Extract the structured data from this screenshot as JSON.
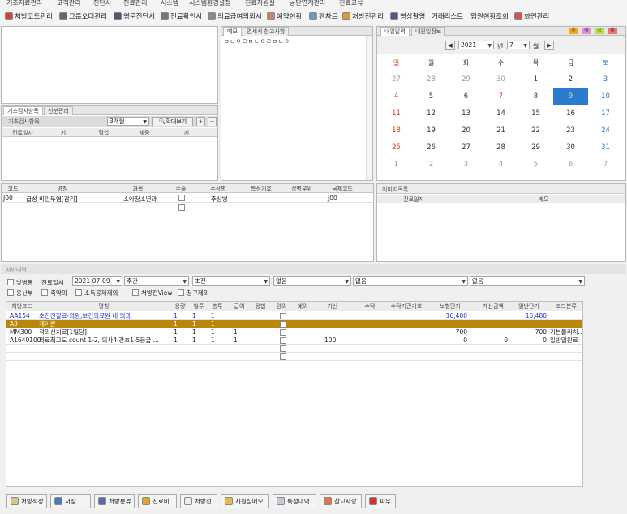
{
  "menu": [
    "기초자료관리",
    "고객관리",
    "진단서",
    "진료관리",
    "시스템",
    "시스템환경설정",
    "진료지원실",
    "공단연계관리",
    "진료교류"
  ],
  "toolbar": [
    {
      "label": "처방코드관리",
      "icon": "prescription-code-icon",
      "color": "#c44"
    },
    {
      "label": "그룹오더관리",
      "icon": "group-order-icon",
      "color": "#666"
    },
    {
      "label": "영문진단서",
      "icon": "english-certificate-icon",
      "color": "#557"
    },
    {
      "label": "진료확인서",
      "icon": "treatment-confirm-icon",
      "color": "#777"
    },
    {
      "label": "의료급여의뢰서",
      "icon": "medical-aid-icon",
      "color": "#888"
    },
    {
      "label": "예약현황",
      "icon": "reservation-icon",
      "color": "#c86"
    },
    {
      "label": "펜차트",
      "icon": "pen-chart-icon",
      "color": "#69c"
    },
    {
      "label": "처방전관리",
      "icon": "prescription-icon",
      "color": "#d93"
    },
    {
      "label": "영상촬영",
      "icon": "camera-icon",
      "color": "#558"
    },
    {
      "label": "거래리스트",
      "icon": "",
      "color": ""
    },
    {
      "label": "입원현황조회",
      "icon": "",
      "color": ""
    },
    {
      "label": "화면관리",
      "icon": "screen-manage-icon",
      "color": "#c55"
    }
  ],
  "exam": {
    "tabs": [
      "기초검사항목",
      "신분관리"
    ],
    "filter_label": "기초검사항목",
    "period": "3개월",
    "zoom_button": "확대보기",
    "columns": [
      "진료일자",
      "키",
      "혈압",
      "체중",
      "키"
    ]
  },
  "memo": {
    "tabs": [
      "메모",
      "명세서 참고사항"
    ],
    "content": "ㅁㄴㅇㄹㅁㄴㅇㄹㅁㄴㅇ"
  },
  "calendar": {
    "tabs": [
      "내일달력",
      "내원일정보"
    ],
    "year": "2021",
    "year_unit": "년",
    "month": "7",
    "month_unit": "월",
    "weekdays": [
      "일",
      "월",
      "화",
      "수",
      "목",
      "금",
      "토"
    ],
    "weeks": [
      [
        "27",
        "28",
        "29",
        "30",
        "1",
        "2",
        "3"
      ],
      [
        "4",
        "5",
        "6",
        "7",
        "8",
        "9",
        "10"
      ],
      [
        "11",
        "12",
        "13",
        "14",
        "15",
        "16",
        "17"
      ],
      [
        "18",
        "19",
        "20",
        "21",
        "22",
        "23",
        "24"
      ],
      [
        "25",
        "26",
        "27",
        "28",
        "29",
        "30",
        "31"
      ],
      [
        "1",
        "2",
        "3",
        "4",
        "5",
        "6",
        "7"
      ]
    ],
    "today": "9",
    "color_boxes": [
      {
        "label": "휴",
        "color": "#f5a623"
      },
      {
        "label": "예",
        "color": "#e38fd8"
      },
      {
        "label": "공",
        "color": "#b6e04a"
      },
      {
        "label": "휴",
        "color": "#e87878"
      }
    ]
  },
  "diagnosis": {
    "columns": [
      "코드",
      "명칭",
      "과목",
      "수술",
      "주상병",
      "특정기호",
      "상병부위",
      "국제코드"
    ],
    "rows": [
      {
        "code": "J00",
        "name": "급성 비인두염[감기]",
        "dept": "소아청소년과",
        "main": "주상병",
        "intl": "J00"
      },
      {
        "code": "",
        "name": "",
        "dept": "",
        "main": "주상병",
        "intl": ""
      }
    ]
  },
  "image_list": {
    "title": "이미지목록",
    "columns": [
      "진료일자",
      "메모"
    ]
  },
  "orders": {
    "section_title": "처방내역",
    "inpatient_label": "낮병동",
    "date_label": "진료일시",
    "date": "2021-07-09",
    "shift": "주간",
    "visit_type": "초진",
    "none1": "없음",
    "none2": "없음",
    "none3": "없음",
    "checks": [
      "응산부",
      "축약의",
      "소득공제제외",
      "처방전View",
      "청구제외"
    ],
    "columns": [
      "처방코드",
      "명칭",
      "용량",
      "일투",
      "총투",
      "급여",
      "용법",
      "원외",
      "예외",
      "가산",
      "수탁",
      "수탁기관기호",
      "보험단가",
      "계산금액",
      "일반단가",
      "코드분류"
    ],
    "rows": [
      {
        "code": "AA154",
        "name": "초진진찰료-의원,보건의료원 내 의과",
        "dose": "1",
        "daily": "1",
        "total": "1",
        "pay": "",
        "ins_price": "16,480",
        "calc": "",
        "gen_price": "16,480",
        "cat": "",
        "style": "blue"
      },
      {
        "code": "A3",
        "name": "케어콘",
        "dose": "1",
        "daily": "1",
        "total": "1",
        "pay": "",
        "ins_price": "",
        "calc": "",
        "gen_price": "",
        "cat": "",
        "style": "selected"
      },
      {
        "code": "MM300",
        "name": "적외선치료[1일당]",
        "dose": "1",
        "daily": "1",
        "total": "1",
        "pay": "1",
        "ins_price": "700",
        "calc": "",
        "gen_price": "700",
        "cat": "기본물리치...",
        "style": "normal"
      },
      {
        "code": "A1640100",
        "name": "의료최고도 count 1-2, 의사4·간호1-5등급 ...",
        "dose": "1",
        "daily": "1",
        "total": "1",
        "pay": "1",
        "add": "100",
        "ins_price": "0",
        "calc": "0",
        "gen_price": "0",
        "cat": "일반입원료",
        "style": "normal"
      }
    ]
  },
  "bottom_buttons": [
    {
      "label": "처방적장",
      "icon": "save-order-icon"
    },
    {
      "label": "저장",
      "icon": "save-icon"
    },
    {
      "label": "처방분류",
      "icon": "classify-icon"
    },
    {
      "label": "진료비",
      "icon": "fee-icon"
    },
    {
      "label": "처방전",
      "icon": "prescription-print-icon"
    },
    {
      "label": "지원실메모",
      "icon": "support-memo-icon"
    },
    {
      "label": "특정내역",
      "icon": "special-detail-icon"
    },
    {
      "label": "참고사항",
      "icon": "note-icon"
    },
    {
      "label": "파우",
      "icon": "first-aid-icon"
    }
  ]
}
